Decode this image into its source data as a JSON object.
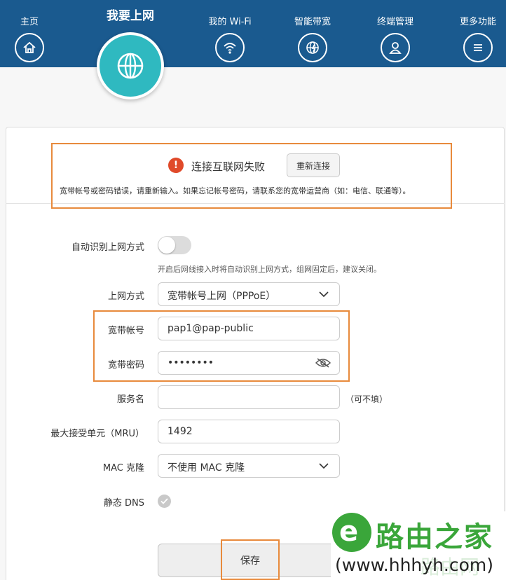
{
  "nav": {
    "home": "主页",
    "internet": "我要上网",
    "wifi": "我的 Wi-Fi",
    "bandwidth": "智能带宽",
    "devices": "终端管理",
    "more": "更多功能"
  },
  "status": {
    "title": "连接互联网失败",
    "reconnect_label": "重新连接",
    "description": "宽带帐号或密码错误，请重新输入。如果忘记帐号密码，请联系您的宽带运营商（如：电信、联通等）。"
  },
  "form": {
    "auto_detect_label": "自动识别上网方式",
    "auto_detect_on": false,
    "auto_detect_hint": "开启后网线接入时将自动识别上网方式，组网固定后，建议关闭。",
    "mode_label": "上网方式",
    "mode_value": "宽带帐号上网（PPPoE）",
    "account_label": "宽带帐号",
    "account_value": "pap1@pap-public",
    "password_label": "宽带密码",
    "password_value": "••••••••",
    "service_label": "服务名",
    "service_value": "",
    "service_optional": "（可不填）",
    "mru_label": "最大接受单元（MRU）",
    "mru_value": "1492",
    "mac_label": "MAC 克隆",
    "mac_value": "不使用 MAC 克隆",
    "dns_label": "静态 DNS",
    "save_label": "保存"
  },
  "watermark": {
    "logo_letter": "e",
    "title": "路由之家",
    "url": "(www.hhhyh.com)",
    "faint_text": "路由网"
  },
  "colors": {
    "nav_bg": "#1a5a8f",
    "active_circle": "#2fb9c0",
    "highlight": "#e88a3c",
    "error": "#e04a2a",
    "brand_green": "#3aa63a"
  }
}
